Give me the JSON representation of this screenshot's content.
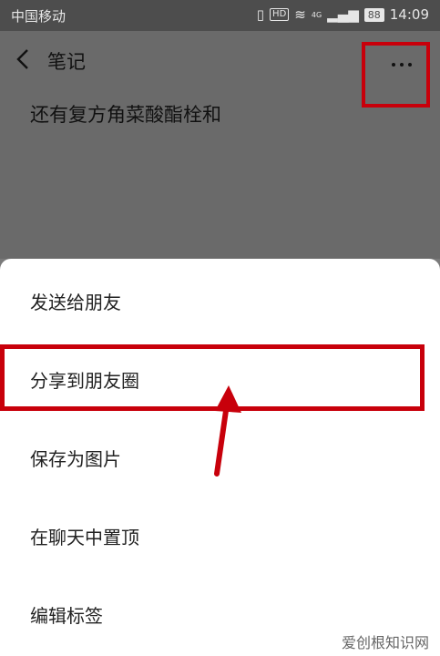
{
  "status_bar": {
    "carrier": "中国移动",
    "network": "4G",
    "battery": "88",
    "time": "14:09",
    "icons": [
      "vibrate-icon",
      "hd-icon",
      "wifi-icon",
      "signal-icon",
      "battery-icon"
    ]
  },
  "header": {
    "title": "笔记",
    "back_icon": "chevron-left-icon",
    "more_icon": "more-dots-icon"
  },
  "note": {
    "title": "还有复方角菜酸酯栓和"
  },
  "menu": {
    "items": [
      {
        "label": "发送给朋友"
      },
      {
        "label": "分享到朋友圈"
      },
      {
        "label": "保存为图片"
      },
      {
        "label": "在聊天中置顶"
      },
      {
        "label": "编辑标签"
      }
    ]
  },
  "annotations": {
    "highlight_color": "#c8000b"
  },
  "watermark": {
    "text": "爱创根知识网"
  }
}
